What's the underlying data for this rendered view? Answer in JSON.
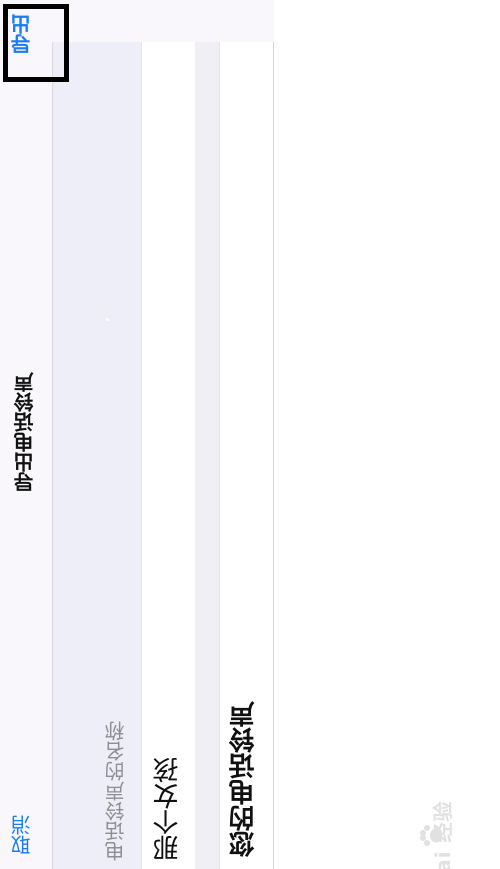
{
  "nav": {
    "cancel_label": "取消",
    "title": "导出电话铃声",
    "export_label": "导出"
  },
  "form": {
    "section_header": "电话铃声的名称",
    "cells": [
      {
        "text": "那个女孩"
      },
      {
        "text": "您的电话铃声"
      }
    ]
  },
  "watermark": {
    "text": "Bai  经验"
  },
  "colors": {
    "accent": "#1a7cf0",
    "highlight": "#000000",
    "secondary_text": "#8e8e93"
  }
}
